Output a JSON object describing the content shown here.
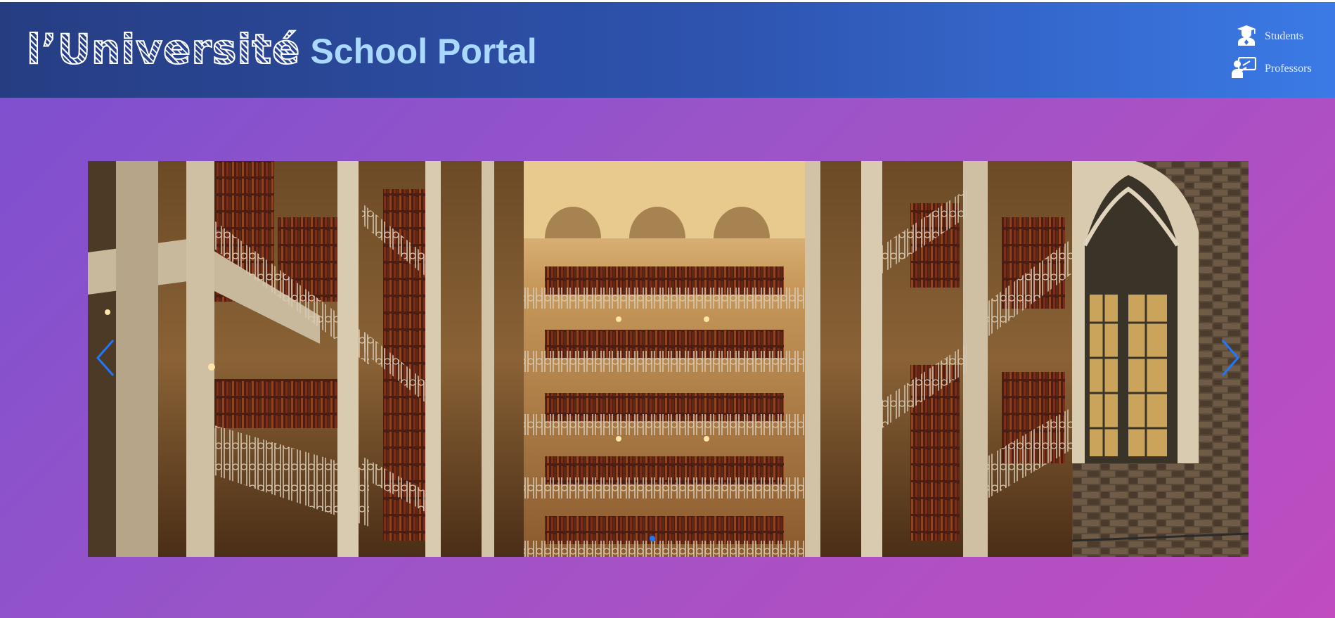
{
  "header": {
    "brand_main": "l’Université",
    "brand_sub": "School Portal",
    "nav": [
      {
        "label": "Students",
        "icon": "graduate-icon"
      },
      {
        "label": "Professors",
        "icon": "teacher-board-icon"
      }
    ]
  },
  "carousel": {
    "slide_description_hidden": "",
    "active_index": 0,
    "accent_color": "#1e78ff"
  },
  "colors": {
    "header_start": "#263d82",
    "header_end": "#3b7ae6",
    "background_start": "#7b4fd0",
    "background_end": "#c04cc0",
    "brand_sub": "#a9d9ff"
  }
}
